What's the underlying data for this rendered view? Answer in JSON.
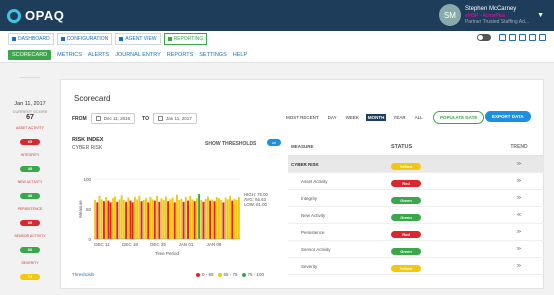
{
  "header": {
    "logo": "OPAQ",
    "user_initials": "SM",
    "user_name": "Stephen McCarney",
    "user_sub": "eMSP - AcmePlus",
    "user_sub2": "Partner Trusted Staffing Ad..."
  },
  "views": [
    {
      "label": "DASHBOARD",
      "active": false
    },
    {
      "label": "CONFIGURATION",
      "active": false
    },
    {
      "label": "AGENT VIEW",
      "active": false
    },
    {
      "label": "REPORTING",
      "active": true
    }
  ],
  "subnav": [
    "SCORECARD",
    "METRICS",
    "ALERTS",
    "JOURNAL ENTRY",
    "REPORTS",
    "SETTINGS",
    "HELP"
  ],
  "sidebar": {
    "date": "Jan 11, 2017",
    "current_label": "CURRENT SCORE",
    "score": "67",
    "items": [
      {
        "label": "ASSET ACTIVITY",
        "value": "65",
        "color": "#d9262f"
      },
      {
        "label": "INTEGRITY",
        "value": "45",
        "color": "#3aa84a"
      },
      {
        "label": "NEW ACTIVITY",
        "value": "40",
        "color": "#3aa84a"
      },
      {
        "label": "PERSISTENCE",
        "value": "65",
        "color": "#d9262f"
      },
      {
        "label": "SENSOR ACTIVITY",
        "value": "60",
        "color": "#3aa84a"
      },
      {
        "label": "SEVERITY",
        "value": "74",
        "color": "#f2c80f"
      }
    ]
  },
  "scorecard": {
    "title": "Scorecard",
    "from_label": "FROM",
    "from_date": "Dec 11, 2016",
    "to_label": "TO",
    "to_date": "Jan 11, 2017",
    "periods": [
      {
        "label": "MOST RECENT",
        "active": false
      },
      {
        "label": "DAY",
        "active": false
      },
      {
        "label": "WEEK",
        "active": false
      },
      {
        "label": "MONTH",
        "active": true
      },
      {
        "label": "YEAR",
        "active": false
      },
      {
        "label": "ALL",
        "active": false
      }
    ],
    "populate": "POPULATE DATE",
    "export": "EXPORT DATA"
  },
  "risk": {
    "title": "RISK INDEX",
    "subtitle": "CYBER RISK",
    "show_thresholds": "SHOW THRESHOLDS",
    "toggle": "on",
    "thresholds_link": "Thresholds",
    "legend": [
      {
        "label": "0 - 65",
        "color": "#d9262f"
      },
      {
        "label": "65 - 75",
        "color": "#f2c80f"
      },
      {
        "label": "75 - 100",
        "color": "#3aa84a"
      }
    ]
  },
  "chart_data": {
    "type": "bar",
    "ylabel": "Measure",
    "xlabel": "Time Period",
    "ylim": [
      0,
      100
    ],
    "yticks": [
      0,
      50,
      100
    ],
    "xtick_labels": [
      "DEC 11",
      "DEC 18",
      "DEC 25",
      "JAN 01",
      "JAN 08"
    ],
    "stats": [
      "HIGH: 75.00",
      "AVG: 66.63",
      "LOW: 61.00"
    ],
    "values": [
      65,
      61,
      72,
      66,
      63,
      70,
      64,
      61,
      68,
      71,
      62,
      66,
      73,
      65,
      62,
      69,
      64,
      61,
      70,
      66,
      72,
      63,
      65,
      68,
      61,
      70,
      66,
      64,
      72,
      62,
      68,
      65,
      71,
      63,
      66,
      69,
      61,
      74,
      65,
      67,
      62,
      70,
      64,
      72,
      66,
      63,
      68,
      75,
      65,
      62,
      67,
      71,
      64,
      66,
      63,
      70,
      68,
      65,
      61,
      69,
      66,
      72,
      64,
      67,
      65,
      70
    ],
    "bar_colors": {
      "low": "#d9262f",
      "mid": "#f2c80f",
      "high": "#3aa84a"
    }
  },
  "table": {
    "headers": [
      "MEASURE",
      "STATUS",
      "TREND"
    ],
    "rows": [
      {
        "measure": "CYBER RISK",
        "status": "Yellow",
        "color": "#f2c80f",
        "trend": "≫",
        "highlight": true
      },
      {
        "measure": "Asset Activity",
        "status": "Red",
        "color": "#d9262f",
        "trend": "≫",
        "highlight": false
      },
      {
        "measure": "Integrity",
        "status": "Green",
        "color": "#3aa84a",
        "trend": "≫",
        "highlight": false
      },
      {
        "measure": "New Activity",
        "status": "Green",
        "color": "#3aa84a",
        "trend": "≪",
        "highlight": false
      },
      {
        "measure": "Persistence",
        "status": "Red",
        "color": "#d9262f",
        "trend": "≫",
        "highlight": false
      },
      {
        "measure": "Sensor Activity",
        "status": "Green",
        "color": "#3aa84a",
        "trend": "≫",
        "highlight": false
      },
      {
        "measure": "Severity",
        "status": "Yellow",
        "color": "#f2c80f",
        "trend": "≫",
        "highlight": false
      }
    ]
  }
}
